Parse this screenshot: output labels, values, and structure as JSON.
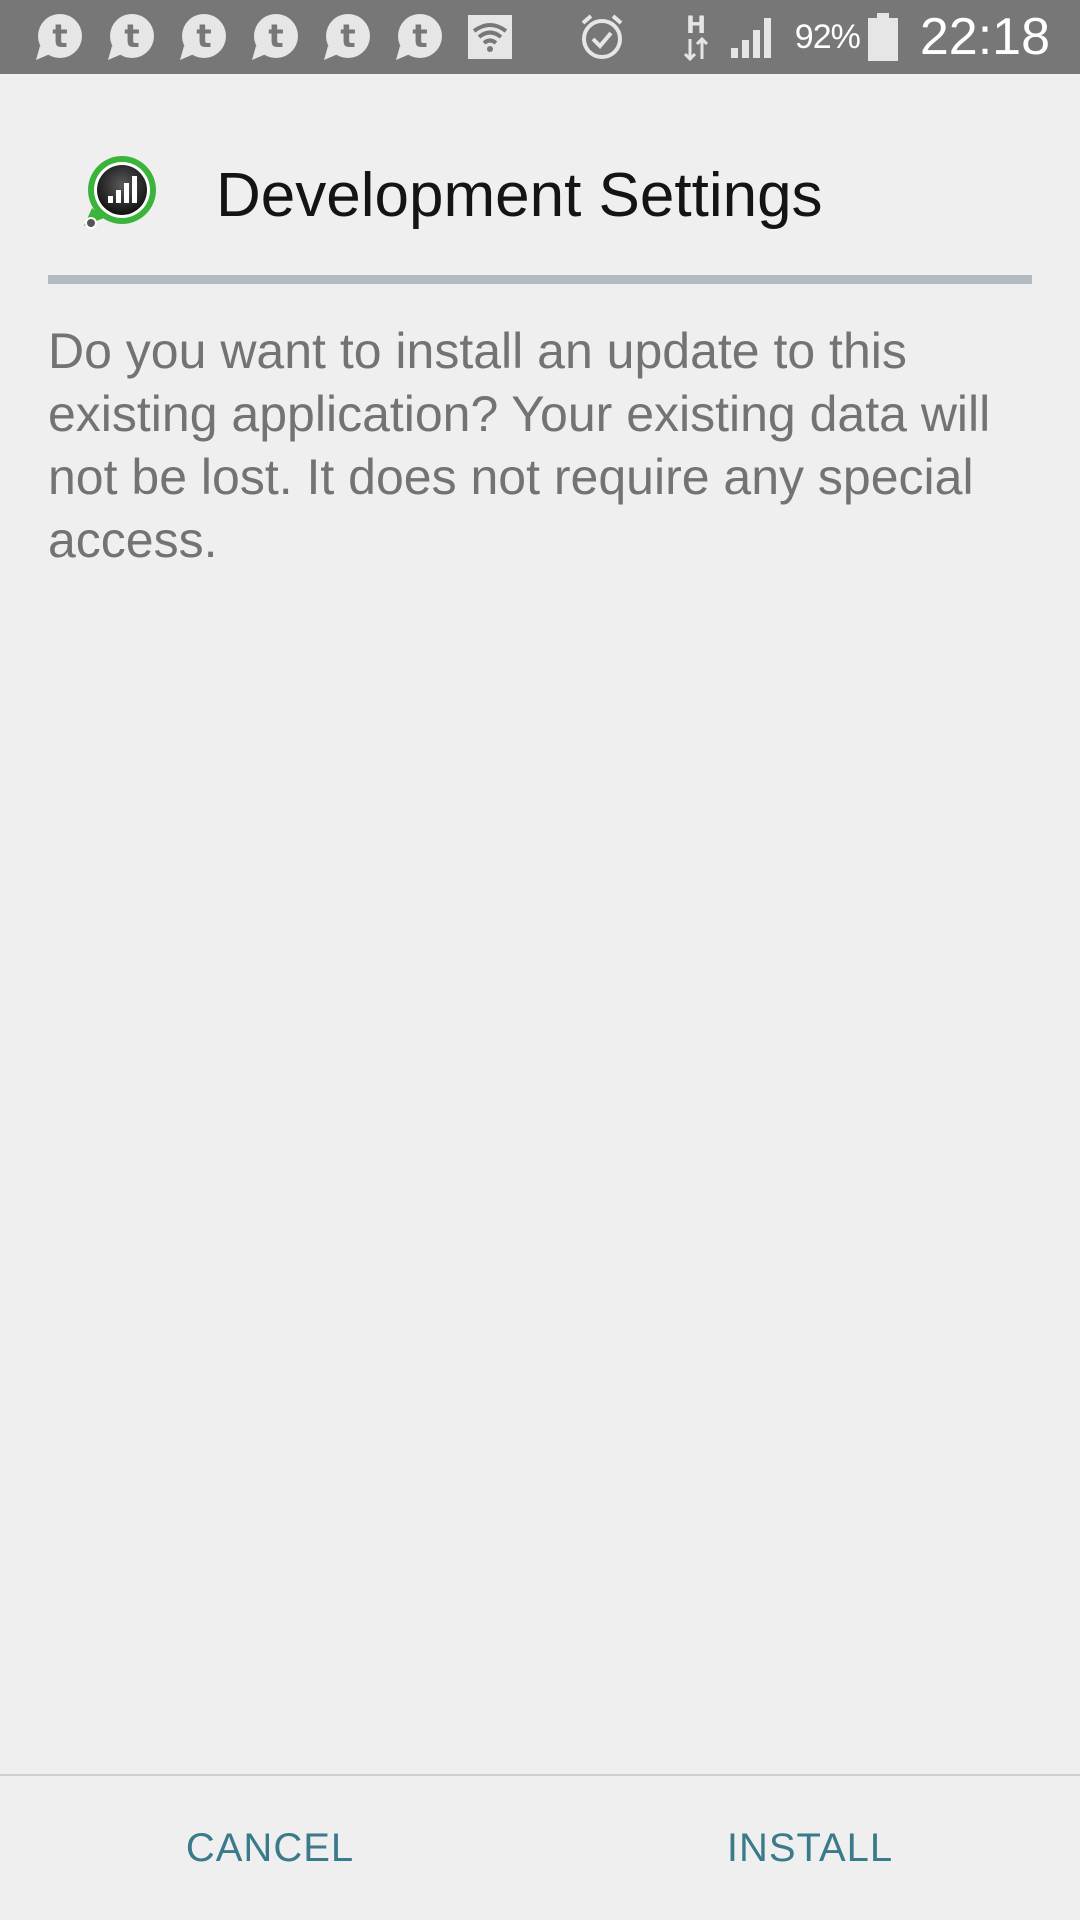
{
  "status_bar": {
    "notification_icons": [
      "tango-icon",
      "tango-icon",
      "tango-icon",
      "tango-icon",
      "tango-icon",
      "tango-icon",
      "wifi-notification-icon"
    ],
    "t_icon_letter": "t",
    "network_type_label": "H",
    "battery_percent": "92%",
    "time": "22:18"
  },
  "dialog": {
    "app_title": "Development Settings",
    "message": "Do you want to install an update to this existing application? Your existing data will not be lost. It does not require any special access.",
    "cancel_label": "CANCEL",
    "install_label": "INSTALL"
  },
  "colors": {
    "status_bar_bg": "#777777",
    "background": "#efeff0",
    "divider": "#b3bac0",
    "button_text": "#3a7a8a",
    "app_icon_ring": "#3cb43c"
  }
}
